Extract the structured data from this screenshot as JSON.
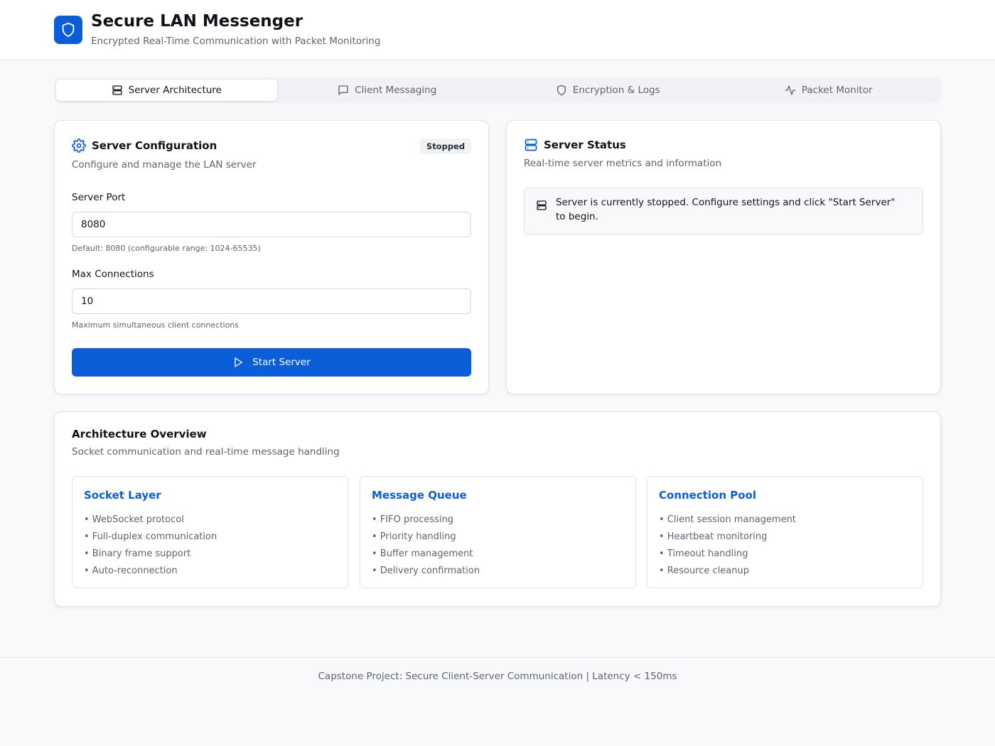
{
  "header": {
    "title": "Secure LAN Messenger",
    "subtitle": "Encrypted Real-Time Communication with Packet Monitoring"
  },
  "tabs": [
    {
      "label": "Server Architecture",
      "icon": "server-icon",
      "active": true
    },
    {
      "label": "Client Messaging",
      "icon": "message-square-icon",
      "active": false
    },
    {
      "label": "Encryption & Logs",
      "icon": "shield-icon",
      "active": false
    },
    {
      "label": "Packet Monitor",
      "icon": "activity-icon",
      "active": false
    }
  ],
  "config": {
    "title": "Server Configuration",
    "description": "Configure and manage the LAN server",
    "status_badge": "Stopped",
    "port_label": "Server Port",
    "port_value": "8080",
    "port_hint": "Default: 8080 (configurable range: 1024-65535)",
    "max_label": "Max Connections",
    "max_value": "10",
    "max_hint": "Maximum simultaneous client connections",
    "start_label": "Start Server"
  },
  "status": {
    "title": "Server Status",
    "description": "Real-time server metrics and information",
    "message": "Server is currently stopped. Configure settings and click \"Start Server\" to begin."
  },
  "architecture": {
    "title": "Architecture Overview",
    "description": "Socket communication and real-time message handling",
    "sections": [
      {
        "title": "Socket Layer",
        "items": [
          "• WebSocket protocol",
          "• Full-duplex communication",
          "• Binary frame support",
          "• Auto-reconnection"
        ]
      },
      {
        "title": "Message Queue",
        "items": [
          "• FIFO processing",
          "• Priority handling",
          "• Buffer management",
          "• Delivery confirmation"
        ]
      },
      {
        "title": "Connection Pool",
        "items": [
          "• Client session management",
          "• Heartbeat monitoring",
          "• Timeout handling",
          "• Resource cleanup"
        ]
      }
    ]
  },
  "footer": {
    "text": "Capstone Project: Secure Client-Server Communication | Latency < 150ms"
  },
  "colors": {
    "accent": "#0b5ed7",
    "muted_text": "#5d6370",
    "border": "#dfe2e8"
  }
}
